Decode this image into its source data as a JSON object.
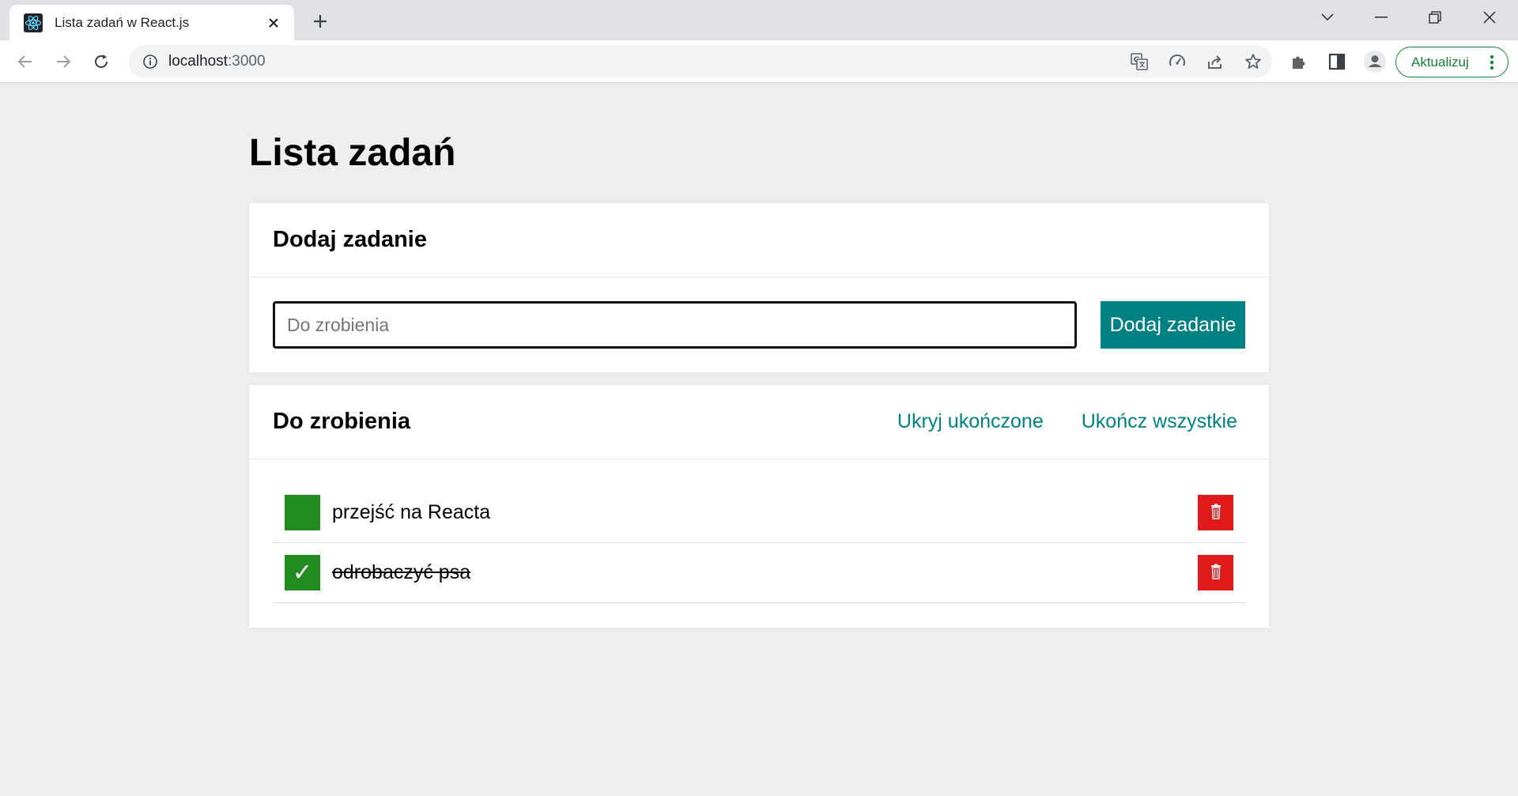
{
  "browser": {
    "tab_title": "Lista zadań w React.js",
    "url_host": "localhost",
    "url_port": ":3000",
    "update_label": "Aktualizuj",
    "icons": {
      "favicon": "react-logo-icon",
      "close_tab": "close-icon",
      "new_tab": "plus-icon",
      "back": "arrow-left-icon",
      "forward": "arrow-right-icon",
      "reload": "reload-icon",
      "site_info": "info-icon",
      "translate": "translate-icon",
      "performance": "speed-gauge-icon",
      "share": "share-icon",
      "bookmark": "star-icon",
      "extensions": "puzzle-icon",
      "side_panel": "side-panel-icon",
      "profile": "profile-icon",
      "menu": "kebab-menu-icon"
    },
    "accent_color": "#188038"
  },
  "page": {
    "title": "Lista zadań"
  },
  "add_section": {
    "title": "Dodaj zadanie",
    "input_placeholder": "Do zrobienia",
    "input_value": "",
    "button_label": "Dodaj zadanie"
  },
  "tasks_section": {
    "title": "Do zrobienia",
    "hide_done_label": "Ukryj ukończone",
    "complete_all_label": "Ukończ wszystkie",
    "tasks": [
      {
        "content": "przejść na Reacta",
        "done": false,
        "toggle_label": ""
      },
      {
        "content": "odrobaczyć psa",
        "done": true,
        "toggle_label": "✓"
      }
    ]
  },
  "colors": {
    "teal": "#008080",
    "green": "#228b22",
    "red": "#e0191b",
    "background": "#eeeeee"
  }
}
